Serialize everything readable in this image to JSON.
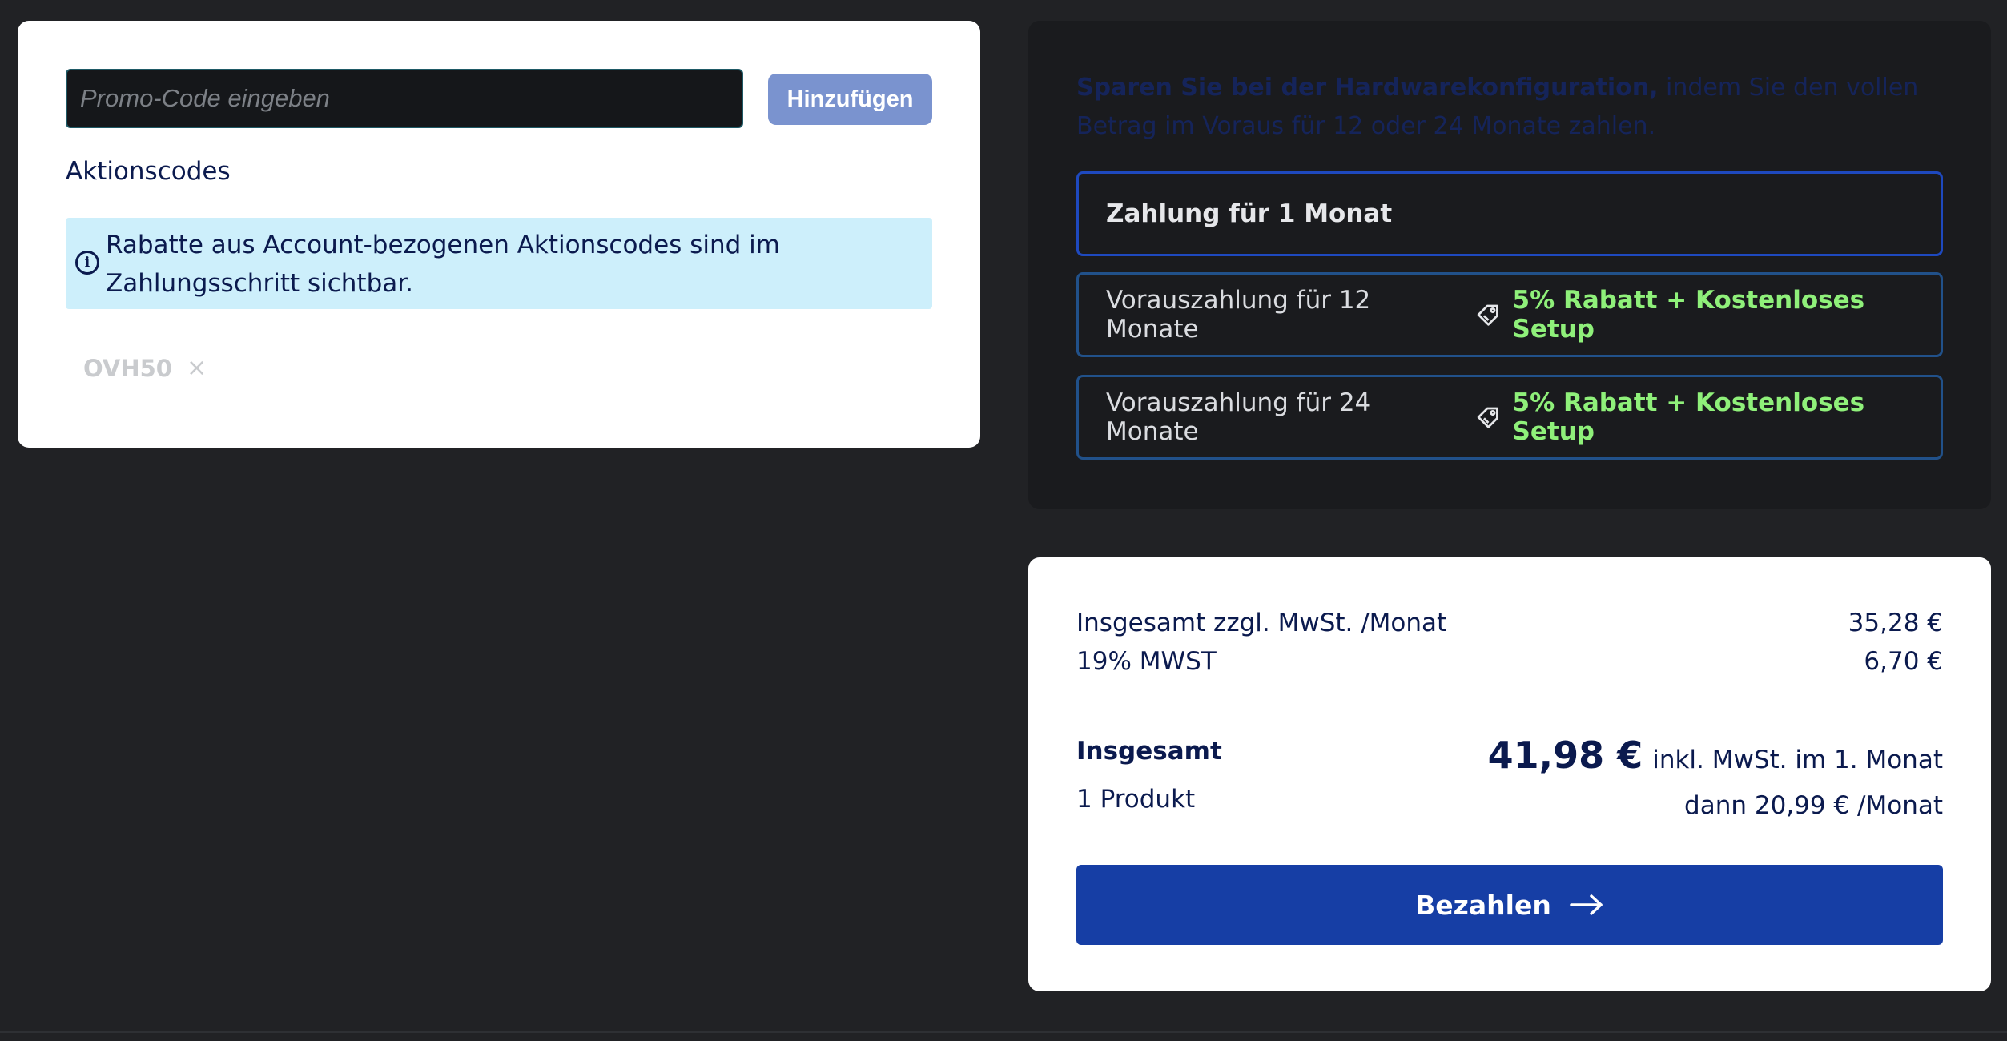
{
  "promo": {
    "placeholder": "Promo-Code eingeben",
    "value": "",
    "add_label": "Hinzufügen",
    "codes_label": "Aktionscodes",
    "info_text": "Rabatte aus Account-bezogenen Aktionscodes sind im Zahlungsschritt sichtbar.",
    "applied_code": "OVH50",
    "remove_symbol": "×"
  },
  "payment": {
    "promo_strong": "Sparen Sie bei der Hardwarekonfiguration,",
    "promo_rest": " indem Sie den vollen Betrag im Voraus für 12 oder 24 Monate zahlen.",
    "options": [
      {
        "label": "Zahlung für 1 Monat",
        "discount": "",
        "selected": true
      },
      {
        "label": "Vorauszahlung für 12 Monate",
        "discount": "5% Rabatt + Kostenloses Setup",
        "selected": false
      },
      {
        "label": "Vorauszahlung für 24 Monate",
        "discount": "5% Rabatt + Kostenloses Setup",
        "selected": false
      }
    ]
  },
  "summary": {
    "subtotal_label": "Insgesamt zzgl. MwSt. /Monat",
    "subtotal_value": "35,28 €",
    "vat_label": "19% MWST",
    "vat_value": "6,70 €",
    "total_label": "Insgesamt",
    "products": "1 Produkt",
    "total_amount": "41,98 €",
    "total_suffix": "inkl. MwSt. im 1. Monat",
    "then_text": "dann 20,99 € /Monat",
    "pay_label": "Bezahlen"
  },
  "colors": {
    "background": "#212225",
    "primary": "#163ea5",
    "discount": "#8ff07a",
    "text": "#0b1a4e"
  },
  "icons": [
    "info-icon",
    "close-icon",
    "tag-icon",
    "arrow-right-icon"
  ]
}
